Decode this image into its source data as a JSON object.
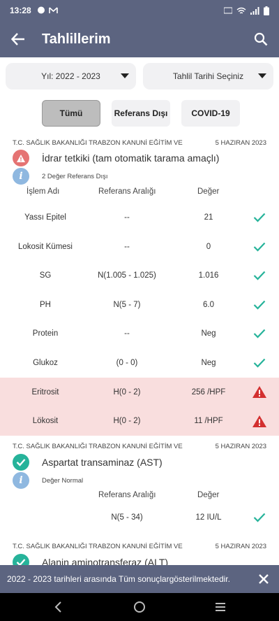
{
  "status": {
    "time": "13:28"
  },
  "appbar": {
    "title": "Tahlillerim"
  },
  "filters": {
    "year": "Yıl: 2022 - 2023",
    "date": "Tahlil Tarihi Seçiniz"
  },
  "chips": [
    "Tümü",
    "Referans Dışı",
    "COVID-19"
  ],
  "columns": {
    "name": "İşlem Adı",
    "range": "Referans Aralığı",
    "value": "Değer"
  },
  "results": [
    {
      "institution": "T.C. SAĞLIK BAKANLIĞI TRABZON KANUNİ EĞİTİM VE",
      "date": "5 HAZIRAN 2023",
      "test": "İdrar tetkiki (tam otomatik tarama amaçlı)",
      "status": "2 Değer Referans Dışı",
      "rows": [
        {
          "name": "Yassı Epitel",
          "range": "--",
          "value": "21",
          "ok": true
        },
        {
          "name": "Lokosit Kümesi",
          "range": "--",
          "value": "0",
          "ok": true
        },
        {
          "name": "SG",
          "range": "N(1.005 - 1.025)",
          "value": "1.016",
          "ok": true
        },
        {
          "name": "PH",
          "range": "N(5 - 7)",
          "value": "6.0",
          "ok": true
        },
        {
          "name": "Protein",
          "range": "--",
          "value": "Neg",
          "ok": true
        },
        {
          "name": "Glukoz",
          "range": "(0 - 0)",
          "value": "Neg",
          "ok": true
        },
        {
          "name": "Eritrosit",
          "range": "H(0 - 2)",
          "value": "256 /HPF",
          "ok": false
        },
        {
          "name": "Lökosit",
          "range": "H(0 - 2)",
          "value": "11 /HPF",
          "ok": false
        }
      ]
    },
    {
      "institution": "T.C. SAĞLIK BAKANLIĞI TRABZON KANUNİ EĞİTİM VE",
      "date": "5 HAZIRAN 2023",
      "test": "Aspartat transaminaz (AST)",
      "status": "Değer Normal",
      "rows": [
        {
          "name": "",
          "range": "N(5 - 34)",
          "value": "12 IU/L",
          "ok": true
        }
      ]
    },
    {
      "institution": "T.C. SAĞLIK BAKANLIĞI TRABZON KANUNİ EĞİTİM VE",
      "date": "5 HAZIRAN 2023",
      "test": "Alanin aminotransferaz (ALT)"
    }
  ],
  "snackbar": {
    "message": "2022 - 2023 tarihleri arasında Tüm sonuçlargösterilmektedir."
  },
  "colors": {
    "primary": "#5c6480",
    "ok": "#26b39a",
    "alert": "#d32f2f",
    "alert_bg": "#f9dede"
  }
}
